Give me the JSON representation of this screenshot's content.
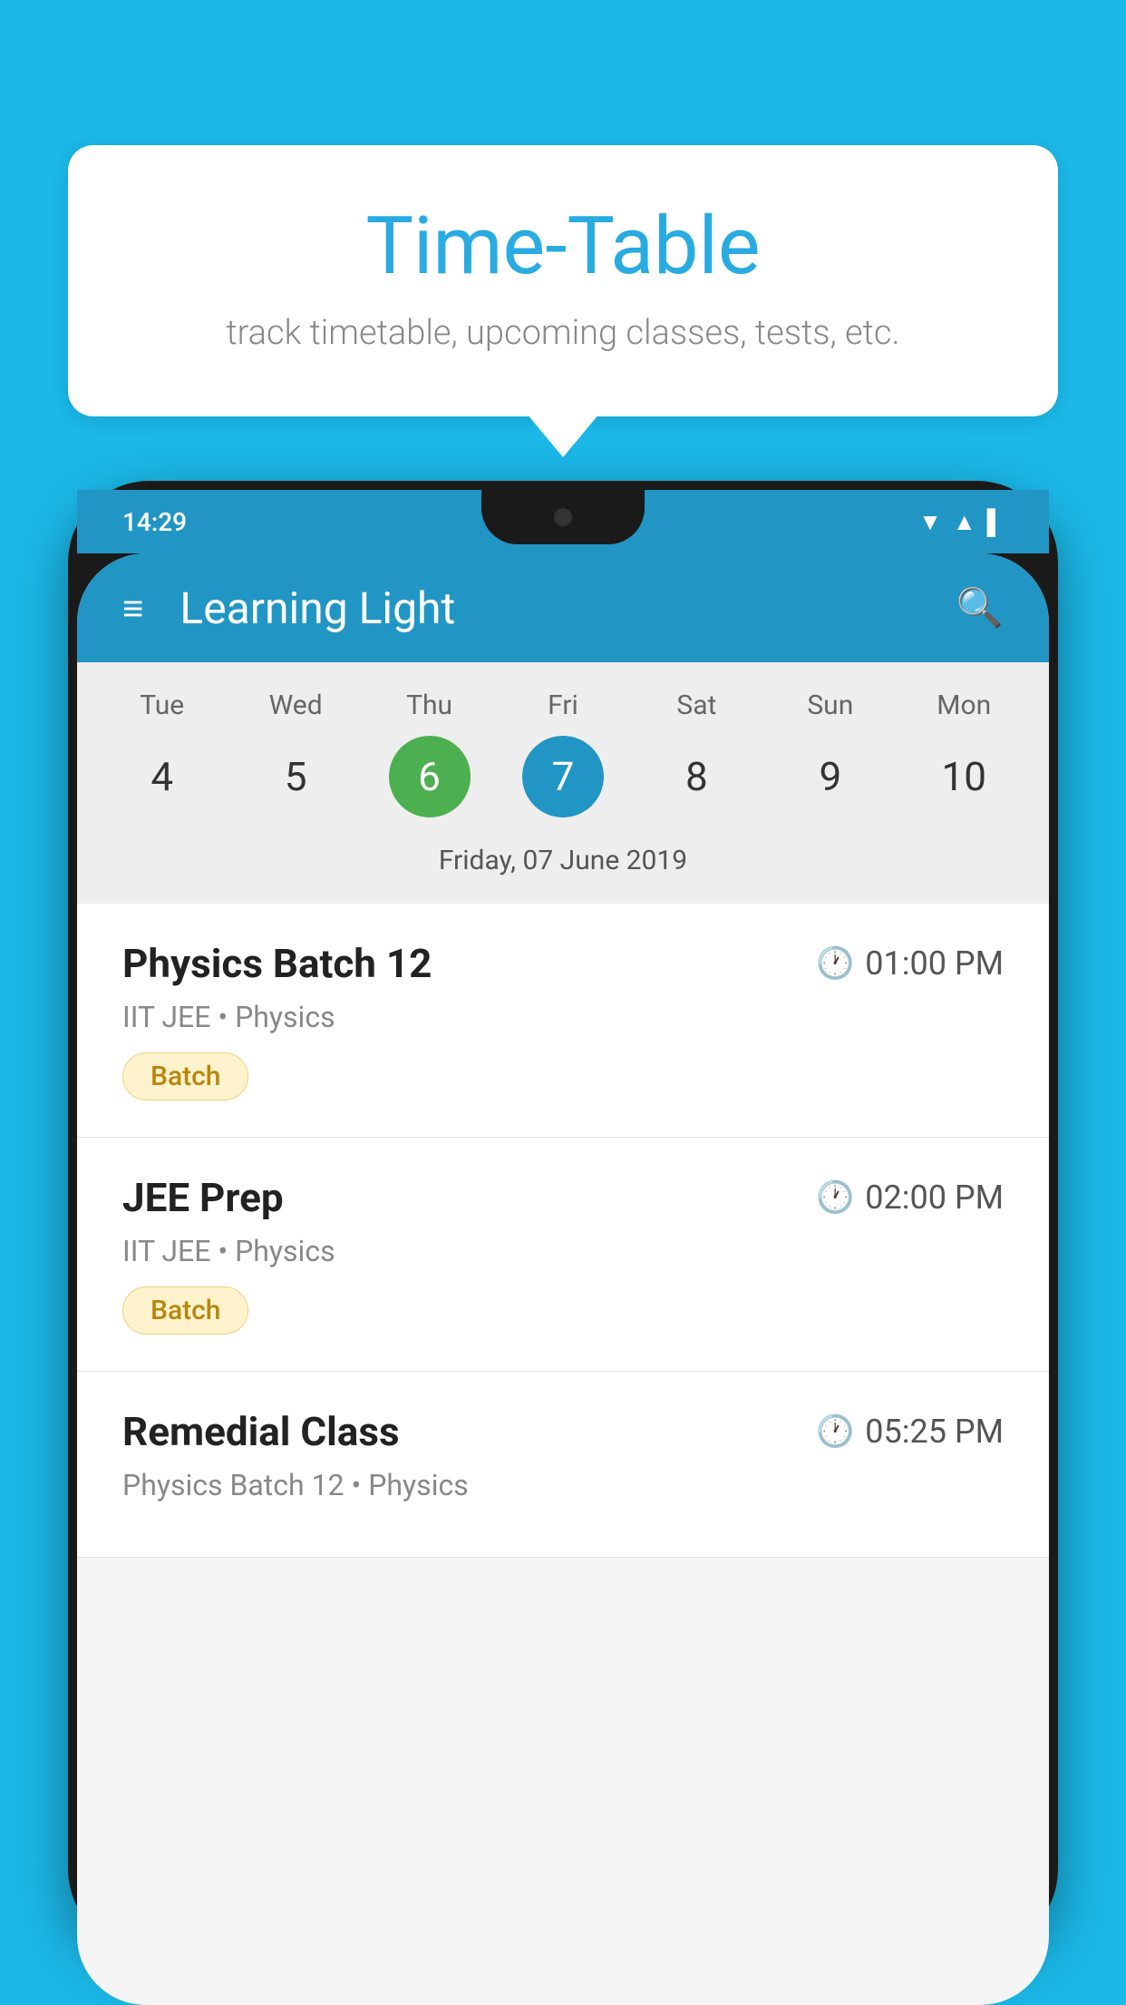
{
  "background_color": "#1BB8E8",
  "bubble": {
    "title": "Time-Table",
    "subtitle": "track timetable, upcoming classes, tests, etc."
  },
  "phone": {
    "status_bar": {
      "time": "14:29"
    },
    "app_bar": {
      "title": "Learning Light",
      "menu_icon": "≡",
      "search_icon": "🔍"
    },
    "calendar": {
      "days": [
        {
          "label": "Tue",
          "number": "4"
        },
        {
          "label": "Wed",
          "number": "5"
        },
        {
          "label": "Thu",
          "number": "6",
          "state": "today"
        },
        {
          "label": "Fri",
          "number": "7",
          "state": "selected"
        },
        {
          "label": "Sat",
          "number": "8"
        },
        {
          "label": "Sun",
          "number": "9"
        },
        {
          "label": "Mon",
          "number": "10"
        }
      ],
      "selected_date_label": "Friday, 07 June 2019"
    },
    "schedule": [
      {
        "title": "Physics Batch 12",
        "time": "01:00 PM",
        "subtitle": "IIT JEE • Physics",
        "tag": "Batch"
      },
      {
        "title": "JEE Prep",
        "time": "02:00 PM",
        "subtitle": "IIT JEE • Physics",
        "tag": "Batch"
      },
      {
        "title": "Remedial Class",
        "time": "05:25 PM",
        "subtitle": "Physics Batch 12 • Physics",
        "tag": null
      }
    ]
  }
}
